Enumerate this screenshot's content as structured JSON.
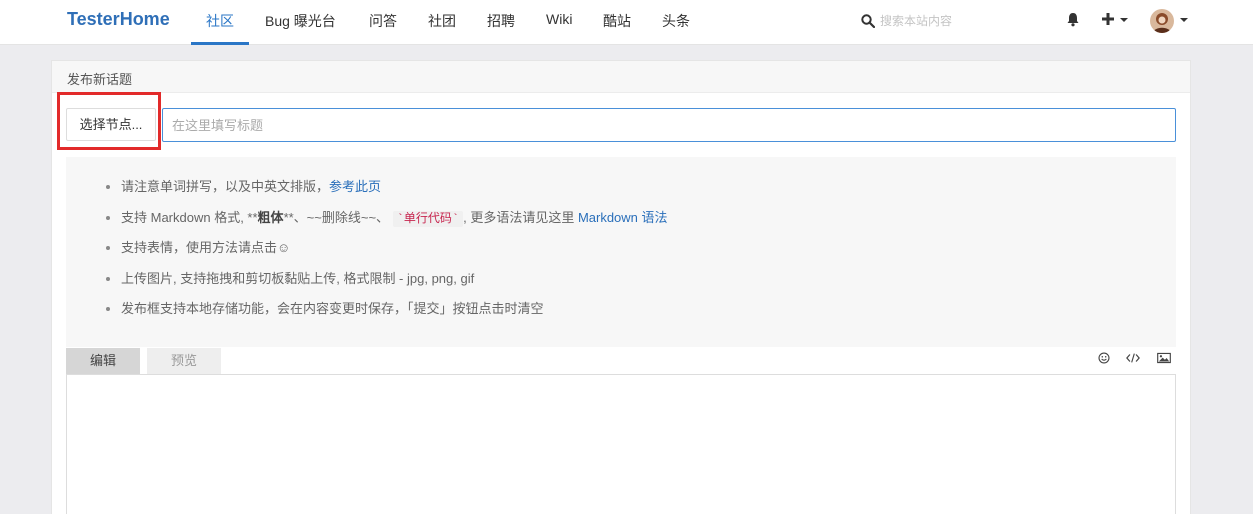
{
  "brand": "TesterHome",
  "nav": {
    "items": [
      {
        "label": "社区",
        "active": true
      },
      {
        "label": "Bug 曝光台",
        "active": false
      },
      {
        "label": "问答",
        "active": false
      },
      {
        "label": "社团",
        "active": false
      },
      {
        "label": "招聘",
        "active": false
      },
      {
        "label": "Wiki",
        "active": false
      },
      {
        "label": "酷站",
        "active": false
      },
      {
        "label": "头条",
        "active": false
      }
    ],
    "search_placeholder": "搜索本站内容",
    "icons": [
      "search-icon",
      "bell-icon",
      "plus-icon",
      "avatar"
    ]
  },
  "panel": {
    "title": "发布新话题",
    "node_button": "选择节点...",
    "title_placeholder": "在这里填写标题"
  },
  "tips": {
    "t1_text": "请注意单词拼写，以及中英文排版，",
    "t1_link": "参考此页",
    "t2_a": "支持 Markdown 格式, **",
    "t2_bold": "粗体",
    "t2_b": "**、~~删除线~~、",
    "t2_code": "`单行代码`",
    "t2_c": ", 更多语法请见这里 ",
    "t2_link": "Markdown 语法",
    "t3": "支持表情，使用方法请点击☺",
    "t4": "上传图片, 支持拖拽和剪切板黏贴上传, 格式限制 - jpg, png, gif",
    "t5": "发布框支持本地存储功能，会在内容变更时保存，「提交」按钮点击时清空"
  },
  "editor": {
    "tab_edit": "编辑",
    "tab_preview": "预览",
    "toolbar_icons": [
      "emoji-icon",
      "code-icon",
      "image-icon"
    ],
    "content": ""
  },
  "colors": {
    "brand": "#2f6fb7",
    "nav_active": "#2a76c6",
    "highlight": "#e22a2a",
    "link": "#2a6fba"
  }
}
